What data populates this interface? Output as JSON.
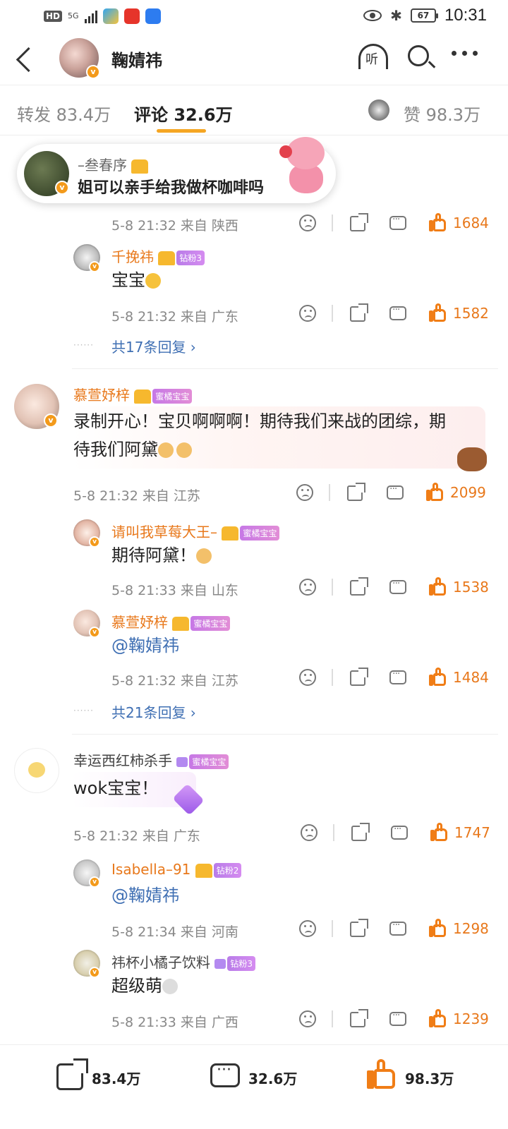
{
  "status_bar": {
    "hd": "HD",
    "network": "5G",
    "battery": "67",
    "time": "10:31"
  },
  "header": {
    "name": "鞠婧祎",
    "listen_label": "听"
  },
  "tabs": {
    "repost_label": "转发 83.4万",
    "comment_label": "评论 32.6万",
    "like_label": "赞 98.3万"
  },
  "pinned": {
    "user": "–叁春序",
    "text": "姐可以亲手给我做杯咖啡吗"
  },
  "comments": [
    {
      "meta": "5-8 21:32  来自 陕西",
      "likes": "1684",
      "replies": [
        {
          "user": "千挽祎",
          "tag": "钻粉3",
          "text": "宝宝",
          "meta": "5-8 21:32  来自 广东",
          "likes": "1582"
        }
      ],
      "more": "共17条回复"
    },
    {
      "user": "慕萱妤梓",
      "tag": "蜜橘宝宝",
      "text_line1": "录制开心！宝贝啊啊啊！期待我们来战的团综，期",
      "text_line2": "待我们阿黛",
      "meta": "5-8 21:32  来自 江苏",
      "likes": "2099",
      "replies": [
        {
          "user": "请叫我草莓大王–",
          "tag": "蜜橘宝宝",
          "text": "期待阿黛！",
          "meta": "5-8 21:33  来自 山东",
          "likes": "1538"
        },
        {
          "user": "慕萱妤梓",
          "tag": "蜜橘宝宝",
          "text": "@鞠婧祎",
          "meta": "5-8 21:32  来自 江苏",
          "likes": "1484"
        }
      ],
      "more": "共21条回复"
    },
    {
      "user": "幸运西红柿杀手",
      "tag": "蜜橘宝宝",
      "text": "wok宝宝！",
      "meta": "5-8 21:32  来自 广东",
      "likes": "1747",
      "replies": [
        {
          "user": "Isabella–91",
          "tag": "钻粉2",
          "text": "@鞠婧祎",
          "meta": "5-8 21:34  来自 河南",
          "likes": "1298"
        },
        {
          "user": "祎杯小橘子饮料",
          "tag": "钻粉3",
          "text": "超级萌",
          "meta": "5-8 21:33  来自 广西",
          "likes": "1239"
        }
      ]
    }
  ],
  "bottom_bar": {
    "repost": "83.4万",
    "comment": "32.6万",
    "like": "98.3万"
  },
  "colors": {
    "accent": "#f5a623",
    "like": "#f07d16",
    "link": "#3f6fb3",
    "username": "#e8781b"
  }
}
